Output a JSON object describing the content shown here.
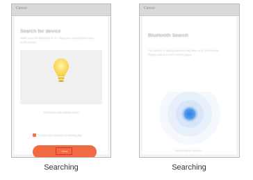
{
  "left_screen": {
    "topbar_title": "Cancel",
    "heading": "Search for device",
    "subtext": "Make sure the Bluetooth is on. Keep your smartphone close to the device.",
    "pairing_text": "Put device into pairing mode",
    "checkbox_label": "Confirm the indicator is blinking fast",
    "next_button_label": "Next"
  },
  "right_screen": {
    "topbar_title": "Cancel",
    "heading": "Bluetooth Search",
    "subtext": "The search of nearby devices may take up to 30 seconds. Please wait and don't exit the page.",
    "footer_text": "Searching for devices..."
  },
  "captions": {
    "left": "Searching",
    "right": "Searching"
  },
  "colors": {
    "accent": "#f06b44",
    "bulb": "#f7d64a",
    "scan_blue": "#2f7fe0"
  }
}
